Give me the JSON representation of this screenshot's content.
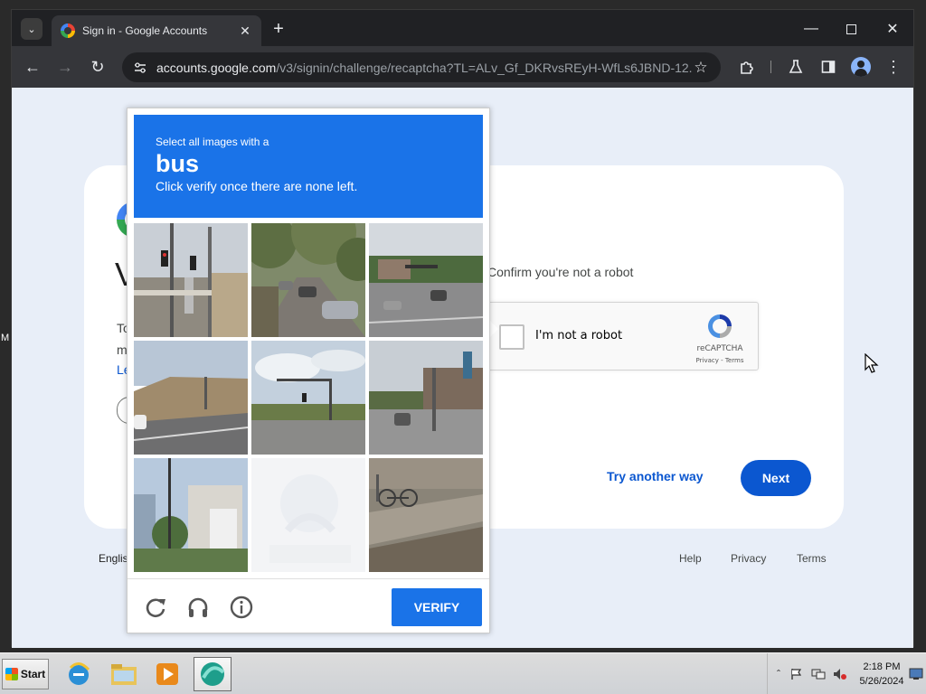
{
  "browser": {
    "tab_title": "Sign in - Google Accounts",
    "url_host": "accounts.google.com",
    "url_path": "/v3/signin/challenge/recaptcha?TL=ALv_Gf_DKRvsREyH-WfLs6JBND-12..."
  },
  "page": {
    "heading_fragment": "V",
    "body_fragment_1": "To",
    "body_fragment_2": "m",
    "link_fragment": "Le",
    "confirm_text": "Confirm you're not a robot",
    "recaptcha_label": "I'm not a robot",
    "recaptcha_brand": "reCAPTCHA",
    "recaptcha_links": "Privacy - Terms",
    "try_another_way": "Try another way",
    "next_button": "Next",
    "footer_language": "Englis",
    "footer_links": [
      "Help",
      "Privacy",
      "Terms"
    ]
  },
  "challenge": {
    "instruction_line1": "Select all images with a",
    "keyword": "bus",
    "instruction_line2": "Click verify once there are none left.",
    "verify_button": "VERIFY",
    "tiles": [
      {
        "scene": "street-traffic-lights"
      },
      {
        "scene": "tree-lined-road-parked-cars"
      },
      {
        "scene": "intersection-cars"
      },
      {
        "scene": "road-hillside"
      },
      {
        "scene": "intersection-clouds"
      },
      {
        "scene": "street-buildings-cars"
      },
      {
        "scene": "modern-building-trees"
      },
      {
        "scene": "faded-loading-tile"
      },
      {
        "scene": "sidewalk-bicycles"
      }
    ]
  },
  "desktop": {
    "edge_letter": "M"
  },
  "taskbar": {
    "start_label": "Start",
    "apps": [
      "internet-explorer",
      "file-explorer",
      "media-player",
      "active-app"
    ],
    "clock_time": "2:18 PM",
    "clock_date": "5/26/2024"
  },
  "colors": {
    "challenge_blue": "#1a73e8",
    "google_blue": "#0b57d0",
    "page_background": "#e8eef8",
    "chrome_dark": "#35363a"
  }
}
